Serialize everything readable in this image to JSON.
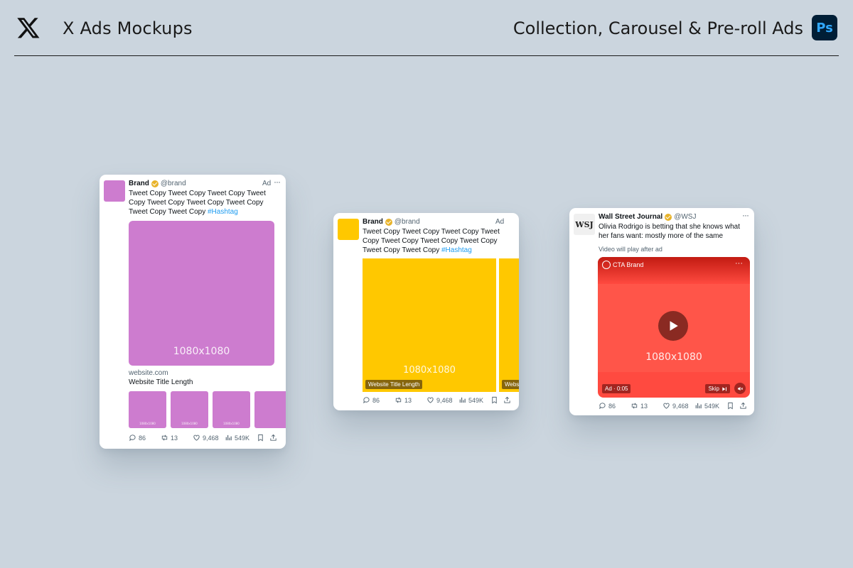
{
  "header": {
    "title": "X Ads Mockups",
    "subtitle": "Collection, Carousel & Pre-roll Ads",
    "ps_badge": "Ps",
    "colors": {
      "background": "#cbd5de",
      "ps_bg": "#001e36",
      "ps_fg": "#31a8ff"
    }
  },
  "collection_card": {
    "name": "Brand",
    "handle": "@brand",
    "ad_label": "Ad",
    "dots": "···",
    "copy": "Tweet Copy Tweet Copy Tweet Copy Tweet Copy Tweet Copy Tweet Copy Tweet Copy Tweet Copy Tweet Copy ",
    "hashtag": "#Hashtag",
    "hero_label": "1080x1080",
    "website": "website.com",
    "website_title": "Website Title Length",
    "thumb_label": "1080x1080",
    "color": "#cd7ccf",
    "stats": {
      "replies": "86",
      "retweets": "13",
      "likes": "9,468",
      "views": "549K"
    }
  },
  "carousel_card": {
    "name": "Brand",
    "handle": "@brand",
    "ad_label": "Ad",
    "dots": "···",
    "copy": "Tweet Copy Tweet Copy Tweet Copy Tweet Copy Tweet Copy Tweet Copy Tweet Copy Tweet Copy Tweet Copy ",
    "hashtag": "#Hashtag",
    "tile_label": "1080x1080",
    "tile_caption": "Website Title Length",
    "next_caption": "Webs",
    "color": "#ffc800",
    "stats": {
      "replies": "86",
      "retweets": "13",
      "likes": "9,468",
      "views": "549K"
    }
  },
  "preroll_card": {
    "name": "Wall Street Journal",
    "handle": "@WSJ",
    "logo": "WSJ",
    "dots": "···",
    "copy": "Olivia Rodrigo is betting that she knows what her fans want: mostly more of the same",
    "notice": "Video will play after ad",
    "cta_brand": "CTA Brand",
    "video_label": "1080x1080",
    "ad_time": "Ad · 0:05",
    "skip_label": "Skip",
    "color": "#ff4a40",
    "stats": {
      "replies": "86",
      "retweets": "13",
      "likes": "9,468",
      "views": "549K"
    }
  }
}
